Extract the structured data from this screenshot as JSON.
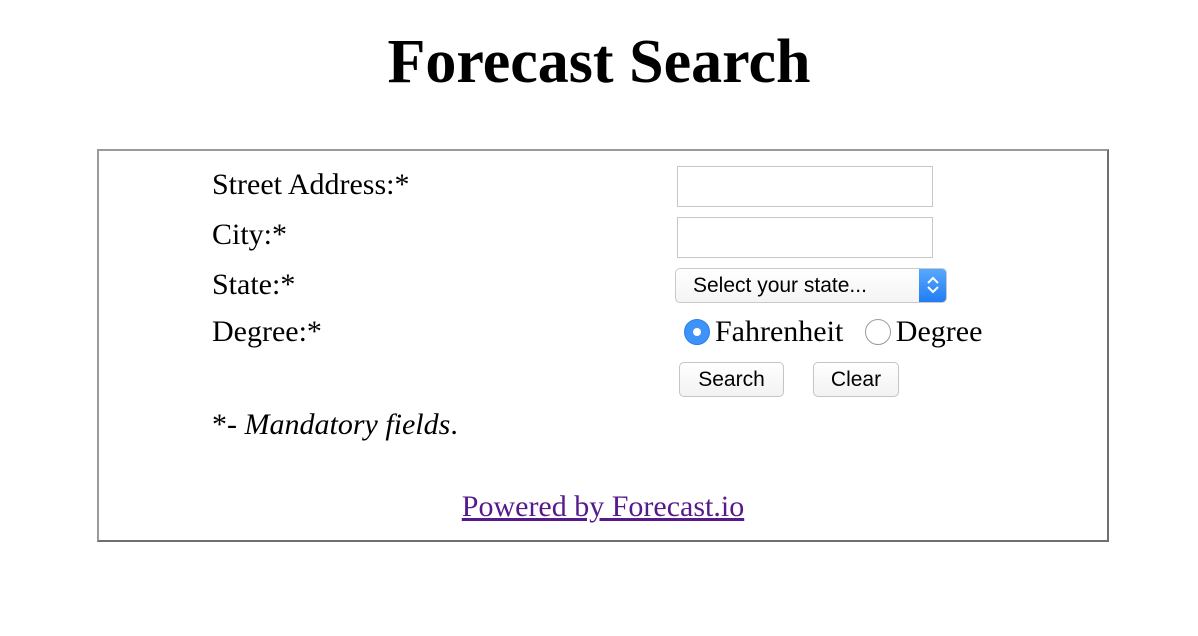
{
  "page": {
    "title": "Forecast Search"
  },
  "form": {
    "street_label": "Street Address:*",
    "street_value": "",
    "city_label": "City:*",
    "city_value": "",
    "state_label": "State:*",
    "state_selected": "Select your state...",
    "degree_label": "Degree:*",
    "degree_options": [
      {
        "label": "Fahrenheit",
        "checked": true
      },
      {
        "label": "Degree",
        "checked": false
      }
    ],
    "search_label": "Search",
    "clear_label": "Clear",
    "note_prefix": "*- ",
    "note_emphasis": "Mandatory fields",
    "note_suffix": "."
  },
  "footer": {
    "link_text": "Powered by Forecast.io",
    "link_color": "#551a8b"
  },
  "colors": {
    "radio_accent": "#3d93f8",
    "select_arrow": "#1f7cf2"
  }
}
